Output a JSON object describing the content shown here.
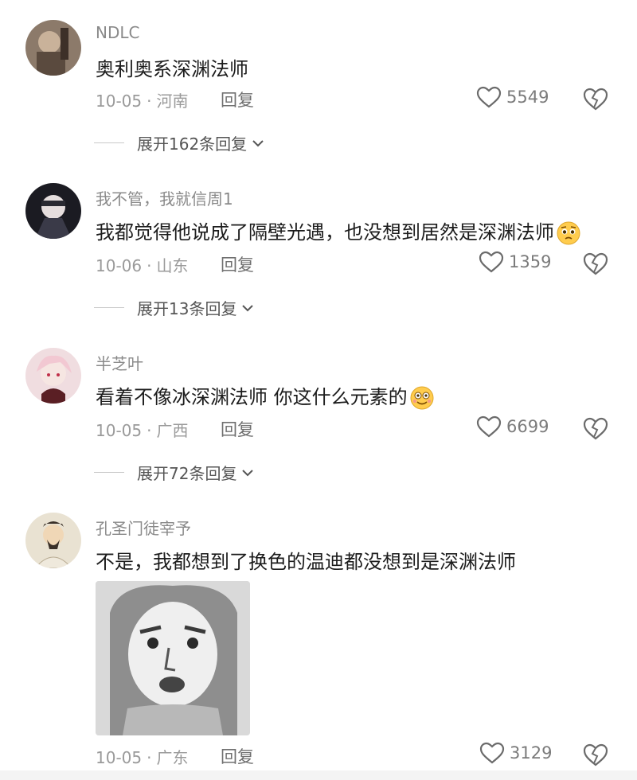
{
  "comments": [
    {
      "username": "NDLC",
      "text": "奥利奥系深渊法师",
      "date": "10-05",
      "location": "河南",
      "reply_label": "回复",
      "likes": "5549",
      "expand": "展开162条回复"
    },
    {
      "username": "我不管，我就信周1",
      "text": "我都觉得他说成了隔壁光遇，也没想到居然是深渊法师",
      "emoji": "pleading-face",
      "date": "10-06",
      "location": "山东",
      "reply_label": "回复",
      "likes": "1359",
      "expand": "展开13条回复"
    },
    {
      "username": "半芝叶",
      "text": "看着不像冰深渊法师  你这什么元素的",
      "emoji": "flushed-smile-face",
      "date": "10-05",
      "location": "广西",
      "reply_label": "回复",
      "likes": "6699",
      "expand": "展开72条回复"
    },
    {
      "username": "孔圣门徒宰予",
      "text": "不是，我都想到了换色的温迪都没想到是深渊法师",
      "has_image": true,
      "date": "10-05",
      "location": "广东",
      "reply_label": "回复",
      "likes": "3129"
    }
  ],
  "separator": "·",
  "icons": {
    "like": "heart-outline-icon",
    "dislike": "broken-heart-icon",
    "expand": "chevron-down-icon"
  },
  "colors": {
    "muted_text": "#9a9a9a",
    "body_text": "#1c1c1c"
  }
}
